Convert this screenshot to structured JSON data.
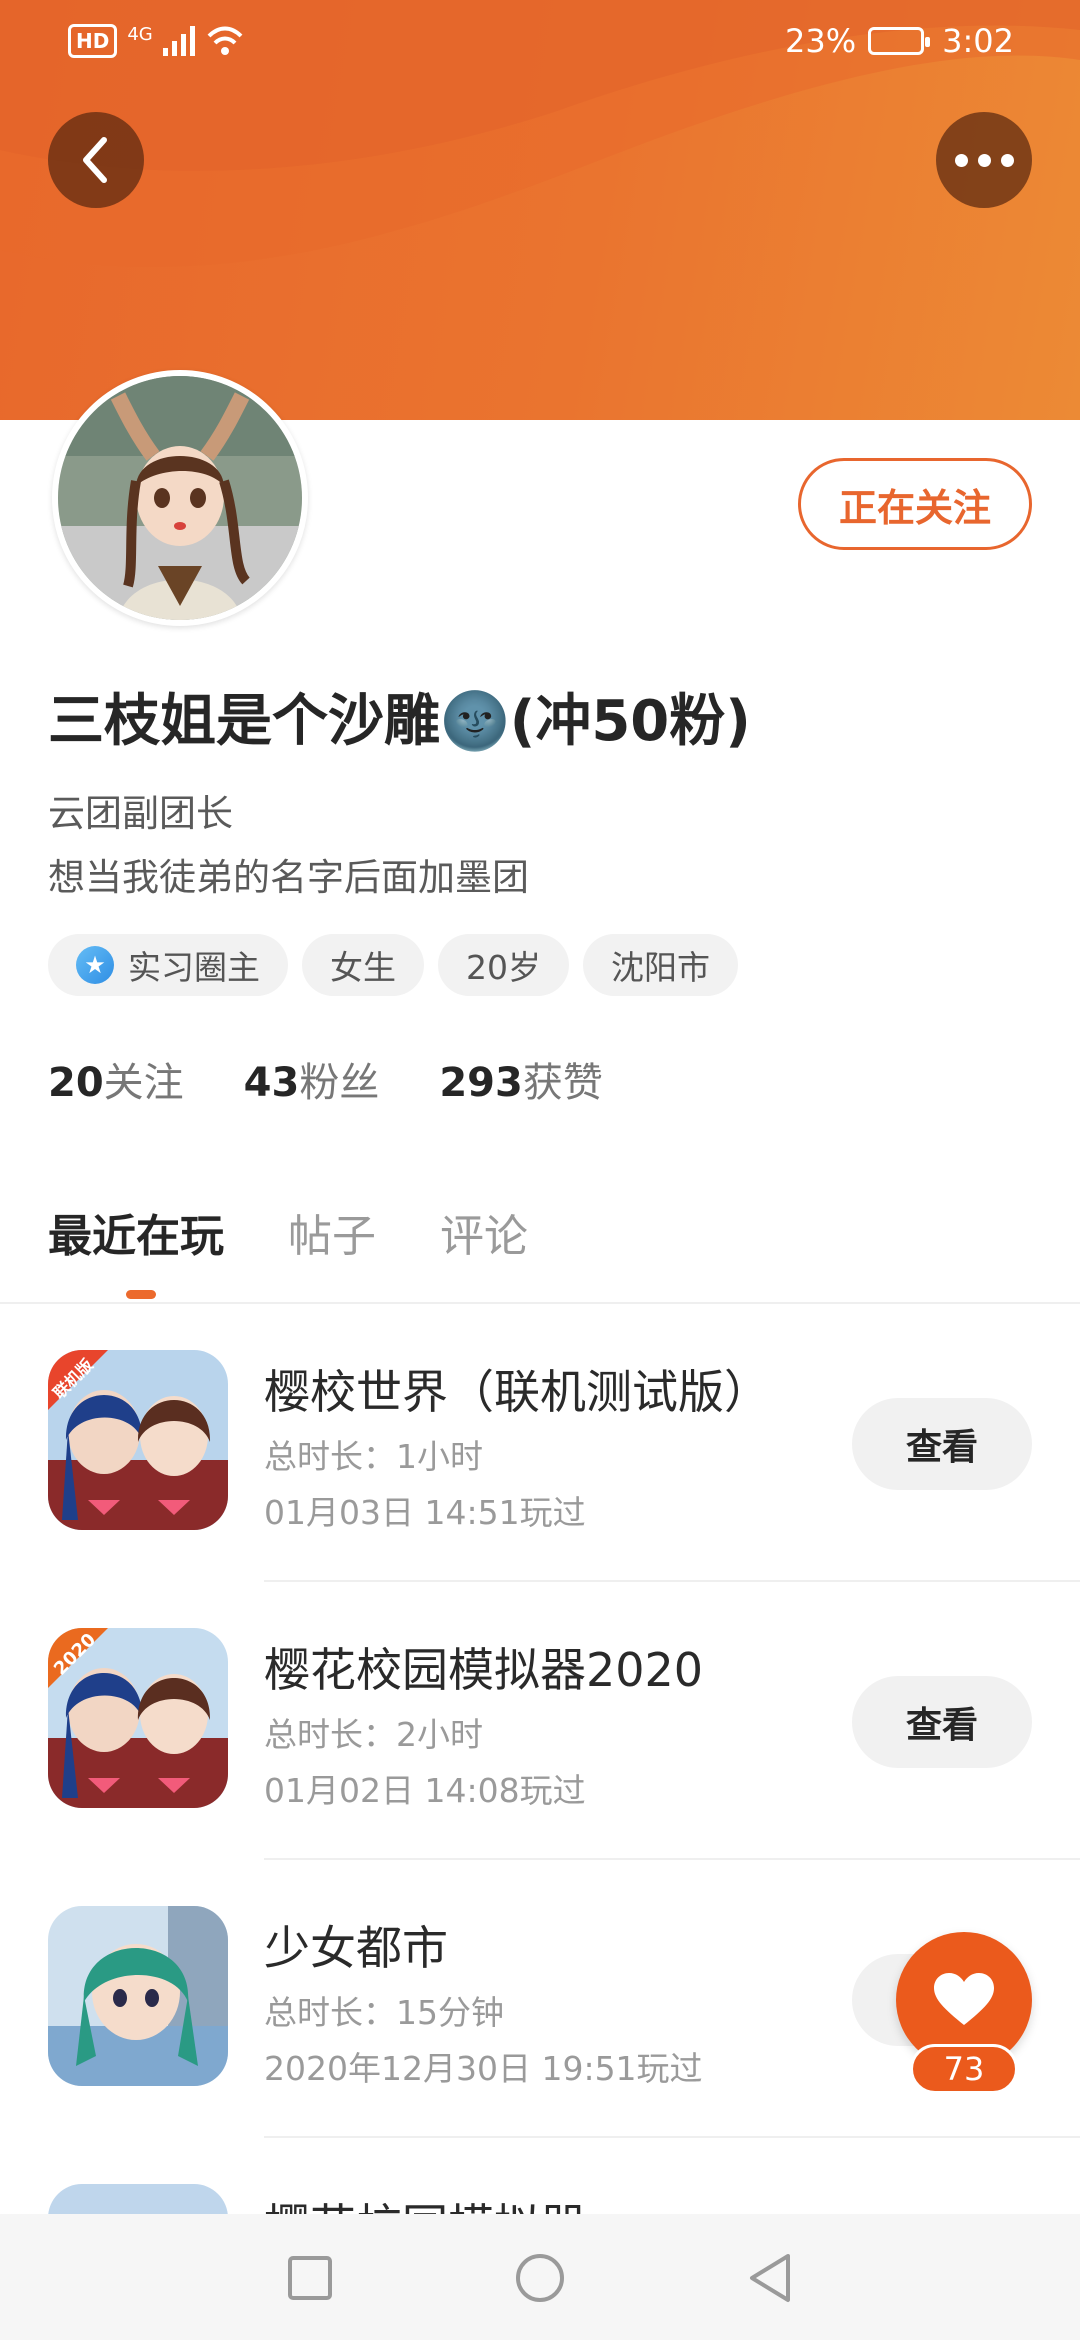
{
  "status_bar": {
    "hd": "HD",
    "network": "4G",
    "battery": "23%",
    "time": "3:02"
  },
  "header": {
    "back_icon": "chevron-left-icon",
    "more_icon": "more-dots-icon"
  },
  "profile": {
    "follow_label": "正在关注",
    "username": "三枝姐是个沙雕🌚(冲50粉)",
    "bio_line1": "云团副团长",
    "bio_line2": "想当我徒弟的名字后面加墨团",
    "tags": [
      {
        "label": "实习圈主",
        "icon": "star-badge-icon"
      },
      {
        "label": "女生"
      },
      {
        "label": "20岁"
      },
      {
        "label": "沈阳市"
      }
    ],
    "stats": [
      {
        "num": "20",
        "label": "关注"
      },
      {
        "num": "43",
        "label": "粉丝"
      },
      {
        "num": "293",
        "label": "获赞"
      }
    ]
  },
  "tabs": [
    {
      "label": "最近在玩",
      "active": true
    },
    {
      "label": "帖子"
    },
    {
      "label": "评论"
    }
  ],
  "games": [
    {
      "title": "樱校世界（联机测试版）",
      "duration": "总时长：1小时",
      "last_played": "01月03日 14:51玩过",
      "badge": "联机版",
      "button": "查看"
    },
    {
      "title": "樱花校园模拟器2020",
      "duration": "总时长：2小时",
      "last_played": "01月02日 14:08玩过",
      "badge": "2020",
      "button": "查看"
    },
    {
      "title": "少女都市",
      "duration": "总时长：15分钟",
      "last_played": "2020年12月30日 19:51玩过",
      "badge": "",
      "button": "查看"
    },
    {
      "title": "樱花校园模拟器",
      "duration": "",
      "last_played": "",
      "badge": "",
      "button": ""
    }
  ],
  "like_fab": {
    "icon": "heart-icon",
    "count": "73"
  },
  "nav": {
    "recent_icon": "square-icon",
    "home_icon": "circle-icon",
    "back_icon": "triangle-back-icon"
  }
}
